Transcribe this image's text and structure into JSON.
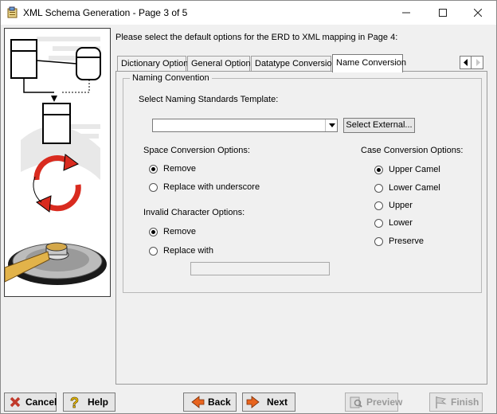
{
  "window": {
    "title": "XML Schema Generation - Page 3 of 5",
    "controls": {
      "minimize": "minimize",
      "maximize": "maximize",
      "close": "close"
    }
  },
  "instruction": "Please select the default options for the ERD to XML mapping in Page 4:",
  "tabs": [
    {
      "label": "Dictionary Options",
      "active": false
    },
    {
      "label": "General Options",
      "active": false
    },
    {
      "label": "Datatype Conversion",
      "active": false
    },
    {
      "label": "Name Conversion",
      "active": true
    }
  ],
  "naming": {
    "group_title": "Naming Convention",
    "template_label": "Select Naming Standards Template:",
    "template_value": "",
    "select_external_label": "Select External...",
    "space": {
      "label": "Space Conversion Options:",
      "options": [
        {
          "label": "Remove",
          "selected": true
        },
        {
          "label": "Replace with underscore",
          "selected": false
        }
      ]
    },
    "invalid": {
      "label": "Invalid Character Options:",
      "options": [
        {
          "label": "Remove",
          "selected": true
        },
        {
          "label": "Replace with",
          "selected": false
        }
      ],
      "replace_value": ""
    },
    "case": {
      "label": "Case Conversion Options:",
      "options": [
        {
          "label": "Upper Camel",
          "selected": true
        },
        {
          "label": "Lower Camel",
          "selected": false
        },
        {
          "label": "Upper",
          "selected": false
        },
        {
          "label": "Lower",
          "selected": false
        },
        {
          "label": "Preserve",
          "selected": false
        }
      ]
    }
  },
  "buttons": {
    "cancel": "Cancel",
    "help": "Help",
    "back": "Back",
    "next": "Next",
    "preview": "Preview",
    "finish": "Finish"
  },
  "colors": {
    "cancel_icon": "#c0392b",
    "help_icon": "#f2c200",
    "nav_arrow": "#e8641e",
    "art_cycle": "#d92b1f"
  }
}
